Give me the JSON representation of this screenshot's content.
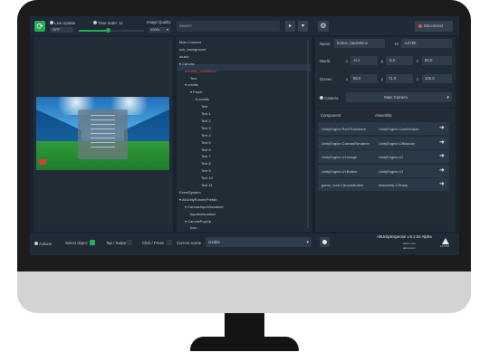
{
  "header": {
    "live_update_label": "Live Update",
    "live_update_value": "OFF",
    "time_scale_label": "Time scale: 1x",
    "time_scale_fraction": 0.45,
    "image_quality_label": "Image Quality",
    "image_quality_value": "100%",
    "search_placeholder": "Search",
    "disconnect_label": "Disconnect"
  },
  "tree": [
    {
      "label": "Main Camera",
      "depth": 0
    },
    {
      "label": "sch_background",
      "depth": 0
    },
    {
      "label": "music",
      "depth": 0
    },
    {
      "label": "▾ Canvas",
      "depth": 0
    },
    {
      "label": "▾ button_backMenu",
      "depth": 1,
      "selected": true
    },
    {
      "label": "Text",
      "depth": 2
    },
    {
      "label": "▾ credits",
      "depth": 1
    },
    {
      "label": "▾ Panel",
      "depth": 2
    },
    {
      "label": "▾ credits",
      "depth": 3
    },
    {
      "label": "Text",
      "depth": 4
    },
    {
      "label": "Text 1",
      "depth": 4
    },
    {
      "label": "Text 2",
      "depth": 4
    },
    {
      "label": "Text 3",
      "depth": 4
    },
    {
      "label": "Text 4",
      "depth": 4
    },
    {
      "label": "Text 5",
      "depth": 4
    },
    {
      "label": "Text 6",
      "depth": 4
    },
    {
      "label": "Text 7",
      "depth": 4
    },
    {
      "label": "Text 8",
      "depth": 4
    },
    {
      "label": "Text 9",
      "depth": 4
    },
    {
      "label": "Text 10",
      "depth": 4
    },
    {
      "label": "Text 11",
      "depth": 4
    },
    {
      "label": "EventSystem",
      "depth": 0
    },
    {
      "label": "▾ AltUnityRunnerPrefab",
      "depth": 0
    },
    {
      "label": "▾ CanvasInputVisualiser",
      "depth": 1
    },
    {
      "label": "InputsVisualiser",
      "depth": 2
    },
    {
      "label": "▾ CanvasPopUp",
      "depth": 1
    },
    {
      "label": "Icon",
      "depth": 2
    }
  ],
  "inspector": {
    "name_label": "Name",
    "name_value": "button_backMenu",
    "id_label": "Id",
    "id_value": "-14750",
    "world_label": "World",
    "world_x": "-0.1",
    "world_y": "-5.0",
    "world_z": "90.0",
    "screen_label": "Screen",
    "screen_x": "55.0",
    "screen_y": "71.0",
    "screen_z": "100.0",
    "axis_x": "x",
    "axis_y": "y",
    "axis_z": "z",
    "camera_label": "Camera",
    "camera_value": "Main Camera",
    "col_component": "Component",
    "col_assembly": "Assembly",
    "components": [
      {
        "component": "UnityEngine.RectTransform",
        "assembly": "UnityEngine.CoreModule"
      },
      {
        "component": "UnityEngine.CanvasRenderer",
        "assembly": "UnityEngine.UIModule"
      },
      {
        "component": "UnityEngine.UI.Image",
        "assembly": "UnityEngine.UI"
      },
      {
        "component": "UnityEngine.UI.Button",
        "assembly": "UnityEngine.UI"
      },
      {
        "component": "game_core.CanvasButton",
        "assembly": "Assembly-CSharp"
      }
    ]
  },
  "footer": {
    "actions_label": "Actions",
    "select_object_label": "Select object",
    "tap_swipe_label": "Tap / Swipe",
    "click_press_label": "Click / Press",
    "current_scene_label": "Current scene",
    "scene_value": "credits",
    "version": "AltUnityInspector v.0.2.63 Alpha",
    "credit_line1": "Altom.com",
    "credit_line2": "altom.com",
    "logo_text": "ALTOM"
  },
  "colors": {
    "accent_green": "#22ad50",
    "disconnect_red": "#e5484d",
    "selected_red": "#e5484d"
  }
}
